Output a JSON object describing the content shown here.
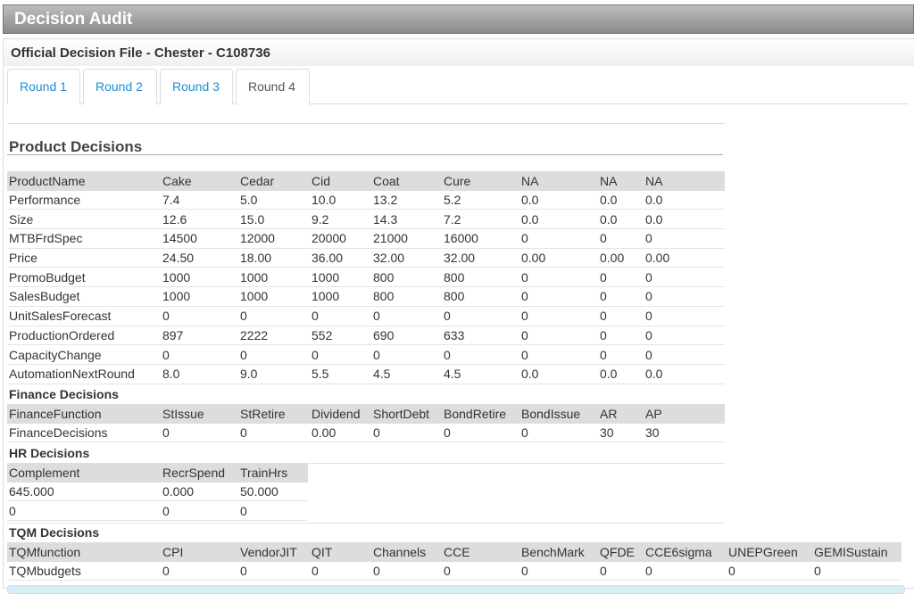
{
  "title": "Decision Audit",
  "subtitle": "Official Decision File - Chester - C108736",
  "tabs": [
    "Round 1",
    "Round 2",
    "Round 3",
    "Round 4"
  ],
  "active_tab": "Round 4",
  "product": {
    "heading": "Product Decisions",
    "header": [
      "ProductName",
      "Cake",
      "Cedar",
      "Cid",
      "Coat",
      "Cure",
      "NA",
      "NA",
      "NA"
    ],
    "rows": [
      [
        "Performance",
        "7.4",
        "5.0",
        "10.0",
        "13.2",
        "5.2",
        "0.0",
        "0.0",
        "0.0"
      ],
      [
        "Size",
        "12.6",
        "15.0",
        "9.2",
        "14.3",
        "7.2",
        "0.0",
        "0.0",
        "0.0"
      ],
      [
        "MTBFrdSpec",
        "14500",
        "12000",
        "20000",
        "21000",
        "16000",
        "0",
        "0",
        "0"
      ],
      [
        "Price",
        "24.50",
        "18.00",
        "36.00",
        "32.00",
        "32.00",
        "0.00",
        "0.00",
        "0.00"
      ],
      [
        "PromoBudget",
        "1000",
        "1000",
        "1000",
        "800",
        "800",
        "0",
        "0",
        "0"
      ],
      [
        "SalesBudget",
        "1000",
        "1000",
        "1000",
        "800",
        "800",
        "0",
        "0",
        "0"
      ],
      [
        "UnitSalesForecast",
        "0",
        "0",
        "0",
        "0",
        "0",
        "0",
        "0",
        "0"
      ],
      [
        "ProductionOrdered",
        "897",
        "2222",
        "552",
        "690",
        "633",
        "0",
        "0",
        "0"
      ],
      [
        "CapacityChange",
        "0",
        "0",
        "0",
        "0",
        "0",
        "0",
        "0",
        "0"
      ],
      [
        "AutomationNextRound",
        "8.0",
        "9.0",
        "5.5",
        "4.5",
        "4.5",
        "0.0",
        "0.0",
        "0.0"
      ]
    ]
  },
  "finance": {
    "heading": "Finance Decisions",
    "header": [
      "FinanceFunction",
      "StIssue",
      "StRetire",
      "Dividend",
      "ShortDebt",
      "BondRetire",
      "BondIssue",
      "AR",
      "AP"
    ],
    "rows": [
      [
        "FinanceDecisions",
        "0",
        "0",
        "0.00",
        "0",
        "0",
        "0",
        "30",
        "30"
      ]
    ]
  },
  "hr": {
    "heading": "HR Decisions",
    "header": [
      "Complement",
      "RecrSpend",
      "TrainHrs"
    ],
    "rows": [
      [
        "645.000",
        "0.000",
        "50.000"
      ],
      [
        "0",
        "0",
        "0"
      ]
    ]
  },
  "tqm": {
    "heading": "TQM Decisions",
    "header": [
      "TQMfunction",
      "CPI",
      "VendorJIT",
      "QIT",
      "Channels",
      "CCE",
      "BenchMark",
      "QFDE",
      "CCE6sigma",
      "UNEPGreen",
      "GEMISustain"
    ],
    "rows": [
      [
        "TQMbudgets",
        "0",
        "0",
        "0",
        "0",
        "0",
        "0",
        "0",
        "0",
        "0",
        "0"
      ]
    ]
  }
}
